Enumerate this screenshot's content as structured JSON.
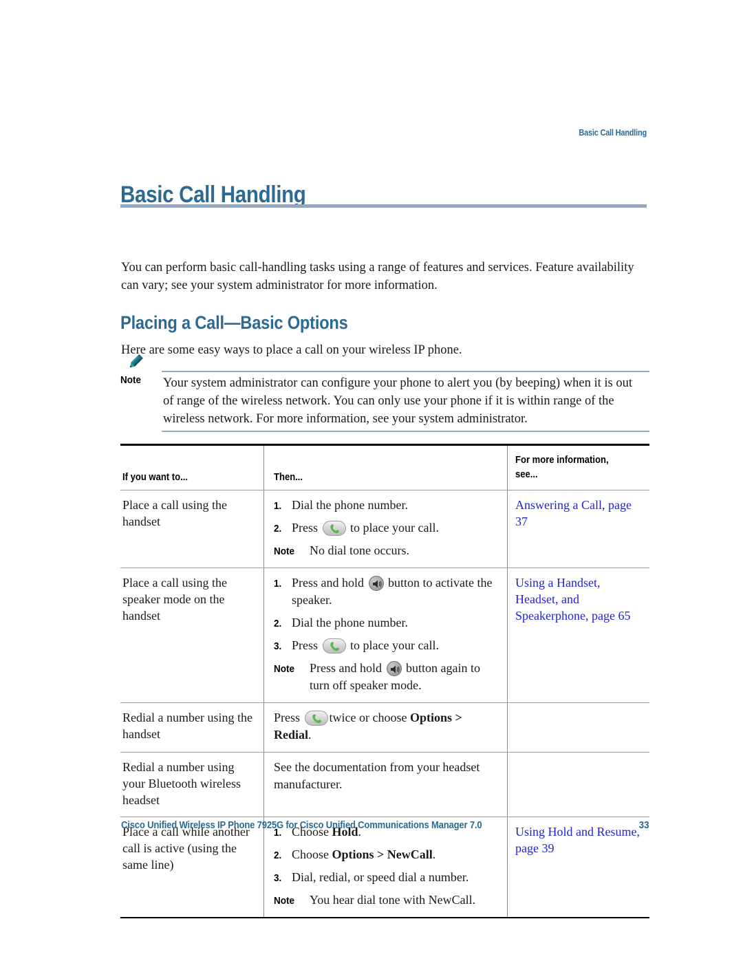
{
  "running_header": "Basic Call Handling",
  "chapter_title": "Basic Call Handling",
  "intro_paragraph": "You can perform basic call-handling tasks using a range of features and services. Feature availability can vary; see your system administrator for more information.",
  "section_title": "Placing a Call—Basic Options",
  "section_lead": "Here are some easy ways to place a call on your wireless IP phone.",
  "note": {
    "icon": "pencil-icon",
    "label": "Note",
    "text": "Your system administrator can configure your phone to alert you (by beeping) when it is out of range of the wireless network. You can only use your phone if it is within range of the wireless network. For more information, see your system administrator."
  },
  "table": {
    "headers": {
      "col1": "If you want to...",
      "col2": "Then...",
      "col3_line1": "For more information,",
      "col3_line2": "see..."
    },
    "rows": [
      {
        "task": "Place a call using the handset",
        "steps": [
          {
            "num": "1.",
            "pre": "Dial the phone number.",
            "icon": "",
            "post": ""
          },
          {
            "num": "2.",
            "pre": "Press",
            "icon": "answer-call-icon",
            "post": "to place your call."
          }
        ],
        "note_label": "Note",
        "note_text": "No dial tone occurs.",
        "xref": "Answering a Call, page 37"
      },
      {
        "task": "Place a call using the speaker mode on the handset",
        "steps": [
          {
            "num": "1.",
            "pre": "Press and hold",
            "icon": "speaker-icon",
            "post": "button to activate the speaker."
          },
          {
            "num": "2.",
            "pre": "Dial the phone number.",
            "icon": "",
            "post": ""
          },
          {
            "num": "3.",
            "pre": "Press",
            "icon": "answer-call-icon",
            "post": "to place your call."
          }
        ],
        "note_label": "Note",
        "note_text_pre": "Press and hold",
        "note_icon": "speaker-icon",
        "note_text_post": "button again to turn off speaker mode.",
        "xref": "Using a Handset, Headset, and Speakerphone, page 65"
      },
      {
        "task": "Redial a number using the handset",
        "inline_pre": "Press",
        "inline_icon": "answer-call-icon",
        "inline_mid": "twice or choose ",
        "inline_bold": "Options > Redial",
        "inline_post": ".",
        "xref": ""
      },
      {
        "task": "Redial a number using your Bluetooth wireless headset",
        "inline_plain": "See the documentation from your headset manufacturer.",
        "xref": ""
      },
      {
        "task": "Place a call while another call is active (using the same line)",
        "steps": [
          {
            "num": "1.",
            "pre": "Choose ",
            "bold": "Hold",
            "post": "."
          },
          {
            "num": "2.",
            "pre": "Choose ",
            "bold": "Options > NewCall",
            "post": "."
          },
          {
            "num": "3.",
            "pre": "Dial, redial, or speed dial a number.",
            "bold": "",
            "post": ""
          }
        ],
        "note_label": "Note",
        "note_text": "You hear dial tone with NewCall.",
        "xref": "Using Hold and Resume, page 39"
      }
    ]
  },
  "footer": {
    "text": "Cisco Unified Wireless IP Phone 7925G for Cisco Unified Communications Manager 7.0",
    "page_number": "33"
  },
  "colors": {
    "cisco_blue": "#2d6a92",
    "rule_blue": "#8fa9c4",
    "xref_blue": "#2323d0",
    "icon_green": "#5cb85c"
  }
}
